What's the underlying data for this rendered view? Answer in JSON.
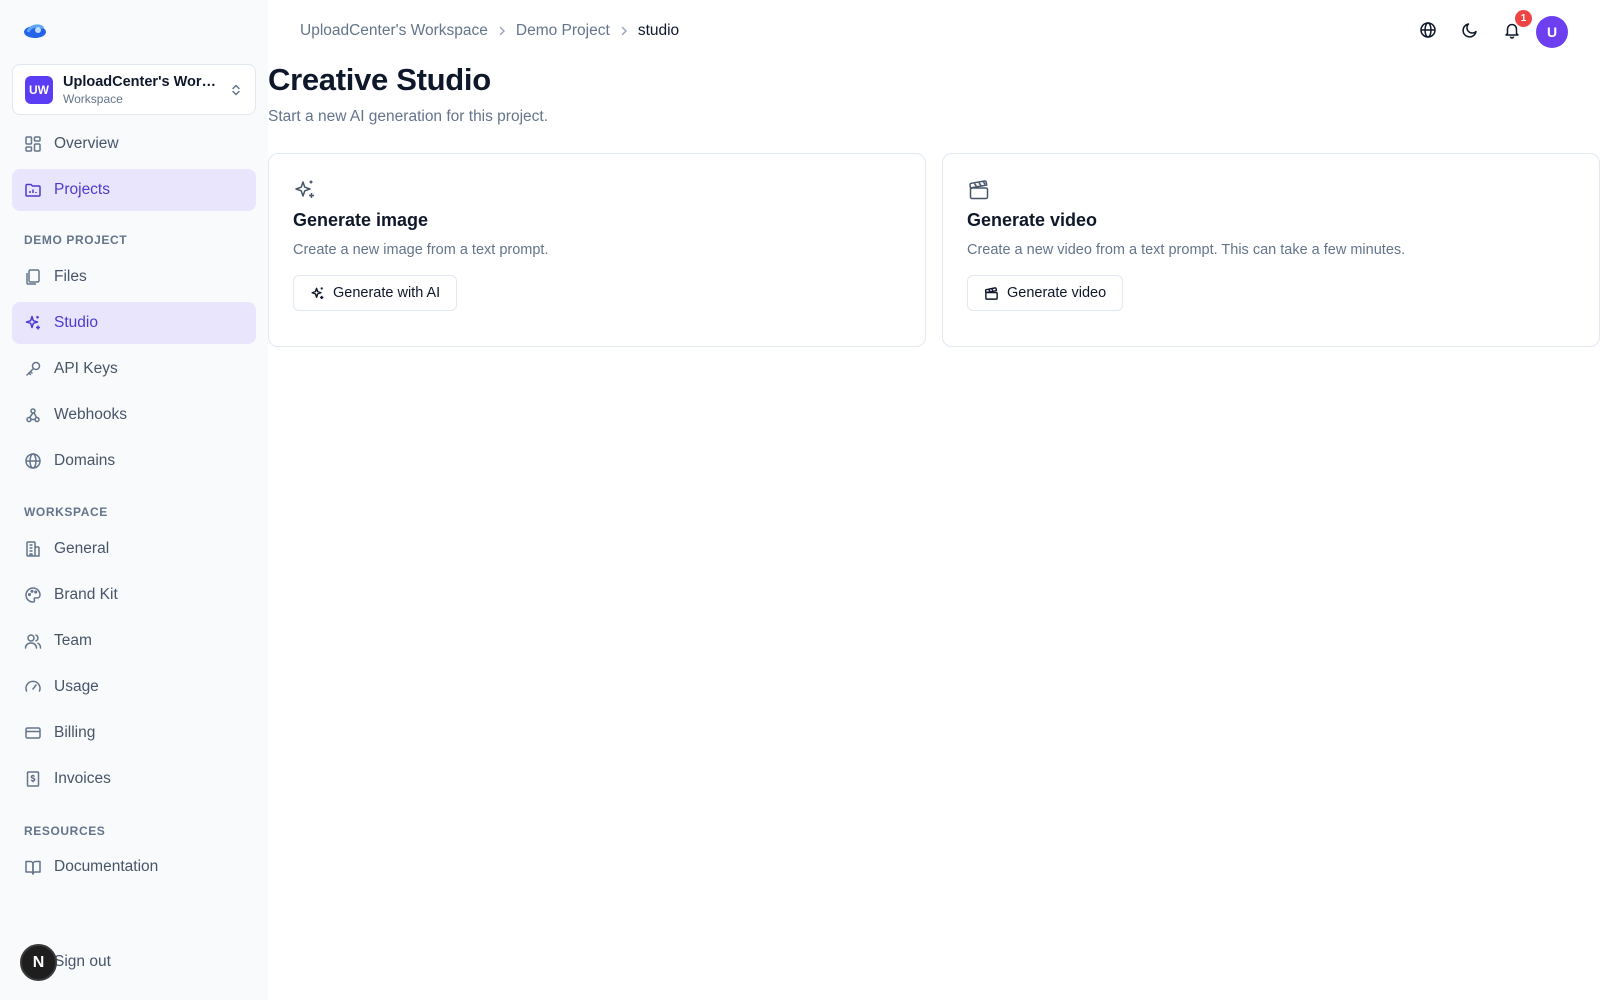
{
  "sidebar": {
    "workspace": {
      "initials": "UW",
      "name": "UploadCenter's Workspace",
      "subtitle": "Workspace"
    },
    "top_items": [
      {
        "label": "Overview",
        "icon": "dashboard-icon",
        "active": false
      },
      {
        "label": "Projects",
        "icon": "folder-chart-icon",
        "active": true
      }
    ],
    "sections": [
      {
        "label": "DEMO PROJECT",
        "items": [
          {
            "label": "Files",
            "icon": "files-icon",
            "active": false
          },
          {
            "label": "Studio",
            "icon": "sparkles-icon",
            "active": true
          },
          {
            "label": "API Keys",
            "icon": "key-icon",
            "active": false
          },
          {
            "label": "Webhooks",
            "icon": "webhook-icon",
            "active": false
          },
          {
            "label": "Domains",
            "icon": "globe-icon",
            "active": false
          }
        ]
      },
      {
        "label": "WORKSPACE",
        "items": [
          {
            "label": "General",
            "icon": "building-icon",
            "active": false
          },
          {
            "label": "Brand Kit",
            "icon": "palette-icon",
            "active": false
          },
          {
            "label": "Team",
            "icon": "users-icon",
            "active": false
          },
          {
            "label": "Usage",
            "icon": "gauge-icon",
            "active": false
          },
          {
            "label": "Billing",
            "icon": "credit-card-icon",
            "active": false
          },
          {
            "label": "Invoices",
            "icon": "receipt-icon",
            "active": false
          }
        ]
      },
      {
        "label": "RESOURCES",
        "items": [
          {
            "label": "Documentation",
            "icon": "book-icon",
            "active": false
          }
        ]
      }
    ],
    "signout_label": "Sign out",
    "next_badge": "N"
  },
  "header": {
    "breadcrumb": [
      "UploadCenter's Workspace",
      "Demo Project",
      "studio"
    ],
    "notification_count": "1",
    "user_initial": "U"
  },
  "main": {
    "title": "Creative Studio",
    "subtitle": "Start a new AI generation for this project.",
    "cards": [
      {
        "icon": "sparkles-icon",
        "title": "Generate image",
        "description": "Create a new image from a text prompt.",
        "button_label": "Generate with AI",
        "button_icon": "sparkles-icon"
      },
      {
        "icon": "clapperboard-icon",
        "title": "Generate video",
        "description": "Create a new video from a text prompt. This can take a few minutes.",
        "button_label": "Generate video",
        "button_icon": "clapperboard-icon"
      }
    ]
  },
  "colors": {
    "accent": "#4c3bcf",
    "accent_bg": "#e9e5fc",
    "sidebar_bg": "#f8fafc",
    "avatar": "#6d3ff0",
    "badge": "#ef4444"
  }
}
